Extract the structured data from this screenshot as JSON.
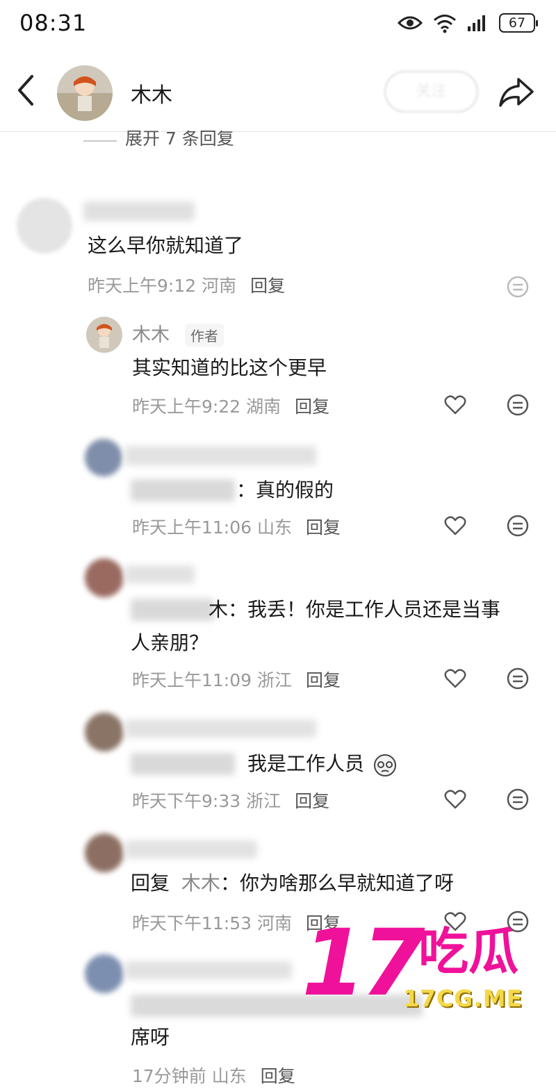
{
  "status": {
    "time": "08:31",
    "battery": "67"
  },
  "header": {
    "name": "木木",
    "follow_label": "关注"
  },
  "expand_label": "展开 7 条回复",
  "comments": [
    {
      "body": "这么早你就知道了",
      "time": "昨天上午9:12",
      "location": "河南",
      "reply": "回复"
    },
    {
      "username": "木木",
      "tag": "作者",
      "body": "其实知道的比这个更早",
      "time": "昨天上午9:22",
      "location": "湖南",
      "reply": "回复"
    },
    {
      "body": "：真的假的",
      "time": "昨天上午11:06",
      "location": "山东",
      "reply": "回复"
    },
    {
      "body_line1": "木：我丢！你是工作人员还是当事",
      "body_line2": "人亲朋？",
      "time": "昨天上午11:09",
      "location": "浙江",
      "reply": "回复"
    },
    {
      "body": "我是工作人员",
      "time": "昨天下午9:33",
      "location": "浙江",
      "reply": "回复"
    },
    {
      "reply_prefix": "回复",
      "reply_to": "木木",
      "body": "：你为啥那么早就知道了呀",
      "time": "昨天下午11:53",
      "location": "河南",
      "reply": "回复"
    },
    {
      "body_line2": "席呀",
      "time": "17分钟前",
      "location": "山东",
      "reply": "回复"
    }
  ],
  "watermark": {
    "big": "17",
    "cn": "吃瓜",
    "url": "17CG.ME"
  },
  "icons": [
    "eye-icon",
    "wifi-icon",
    "signal-icon",
    "battery-icon",
    "back-icon",
    "share-icon",
    "heart-icon",
    "dislike-face-icon"
  ]
}
